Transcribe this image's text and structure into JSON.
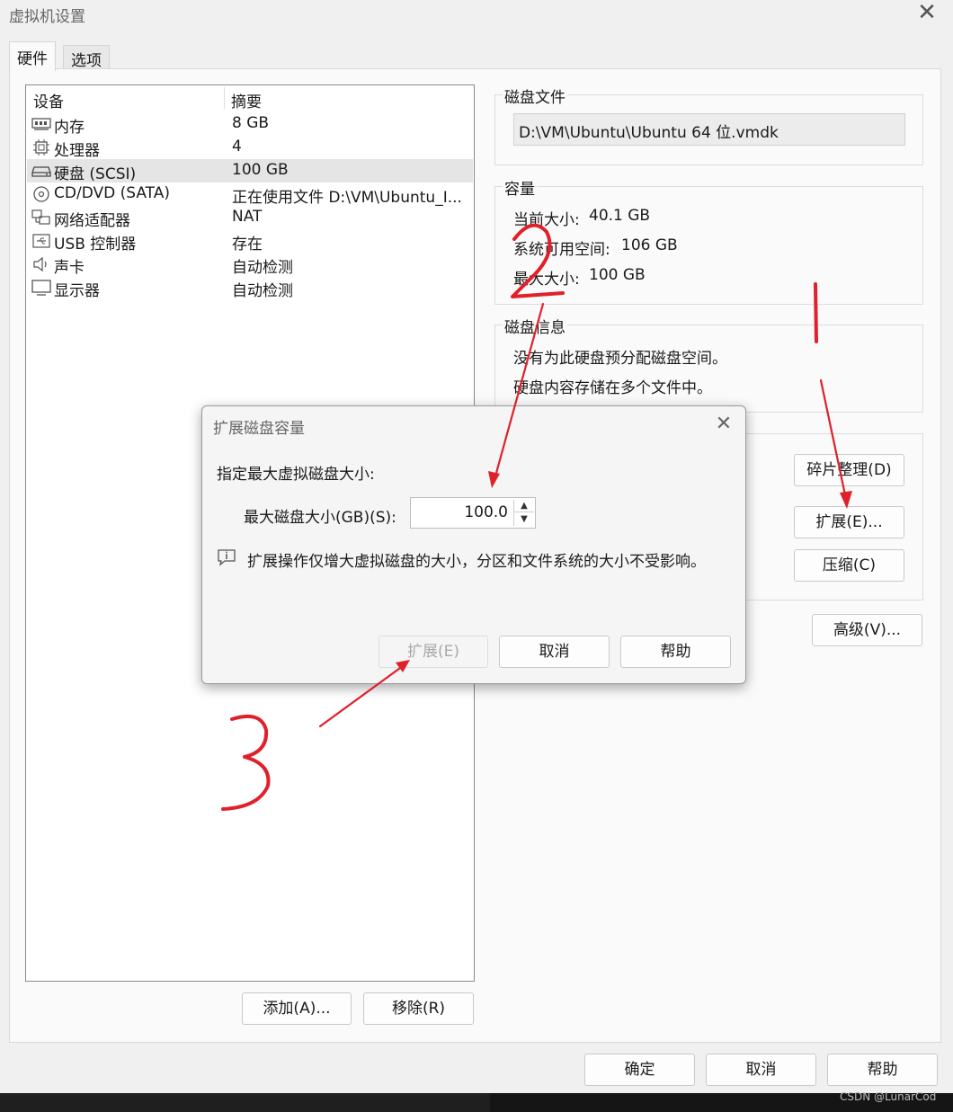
{
  "window": {
    "title": "虚拟机设置",
    "close_glyph": "✕"
  },
  "tabs": [
    {
      "label": "硬件"
    },
    {
      "label": "选项"
    }
  ],
  "device_list": {
    "col_device": "设备",
    "col_summary": "摘要",
    "rows": [
      {
        "name": "内存",
        "summary": "8 GB",
        "icon": "memory-icon"
      },
      {
        "name": "处理器",
        "summary": "4",
        "icon": "processor-icon"
      },
      {
        "name": "硬盘 (SCSI)",
        "summary": "100 GB",
        "icon": "harddisk-icon",
        "selected": true
      },
      {
        "name": "CD/DVD (SATA)",
        "summary": "正在使用文件 D:\\VM\\Ubuntu_I...",
        "icon": "cd-dvd-icon"
      },
      {
        "name": "网络适配器",
        "summary": "NAT",
        "icon": "network-adapter-icon"
      },
      {
        "name": "USB 控制器",
        "summary": "存在",
        "icon": "usb-icon"
      },
      {
        "name": "声卡",
        "summary": "自动检测",
        "icon": "speaker-icon"
      },
      {
        "name": "显示器",
        "summary": "自动检测",
        "icon": "monitor-icon"
      }
    ],
    "add_button": "添加(A)...",
    "remove_button": "移除(R)"
  },
  "disk_file": {
    "title": "磁盘文件",
    "path": "D:\\VM\\Ubuntu\\Ubuntu 64 位.vmdk"
  },
  "capacity": {
    "title": "容量",
    "current_label": "当前大小:",
    "current_value": "40.1 GB",
    "free_label": "系统可用空间:",
    "free_value": "106 GB",
    "max_label": "最大大小:",
    "max_value": "100 GB"
  },
  "disk_info": {
    "title": "磁盘信息",
    "line1": "没有为此硬盘预分配磁盘空间。",
    "line2": "硬盘内容存储在多个文件中。"
  },
  "utility": {
    "defrag_button": "碎片整理(D)",
    "expand_button": "扩展(E)...",
    "compact_button": "压缩(C)"
  },
  "advanced_button": "高级(V)...",
  "footer": {
    "ok_button": "确定",
    "cancel_button": "取消",
    "help_button": "帮助"
  },
  "dialog": {
    "title": "扩展磁盘容量",
    "prompt": "指定最大虚拟磁盘大小:",
    "size_label": "最大磁盘大小(GB)(S):",
    "size_value": "100.0",
    "info_text": "扩展操作仅增大虚拟磁盘的大小，分区和文件系统的大小不受影响。",
    "expand_button": "扩展(E)",
    "cancel_button": "取消",
    "help_button": "帮助",
    "close_glyph": "✕"
  },
  "annotations": {
    "step1": "1",
    "step2": "2",
    "step3": "3",
    "color": "#e0202a"
  },
  "watermark": "CSDN @LunarCod"
}
